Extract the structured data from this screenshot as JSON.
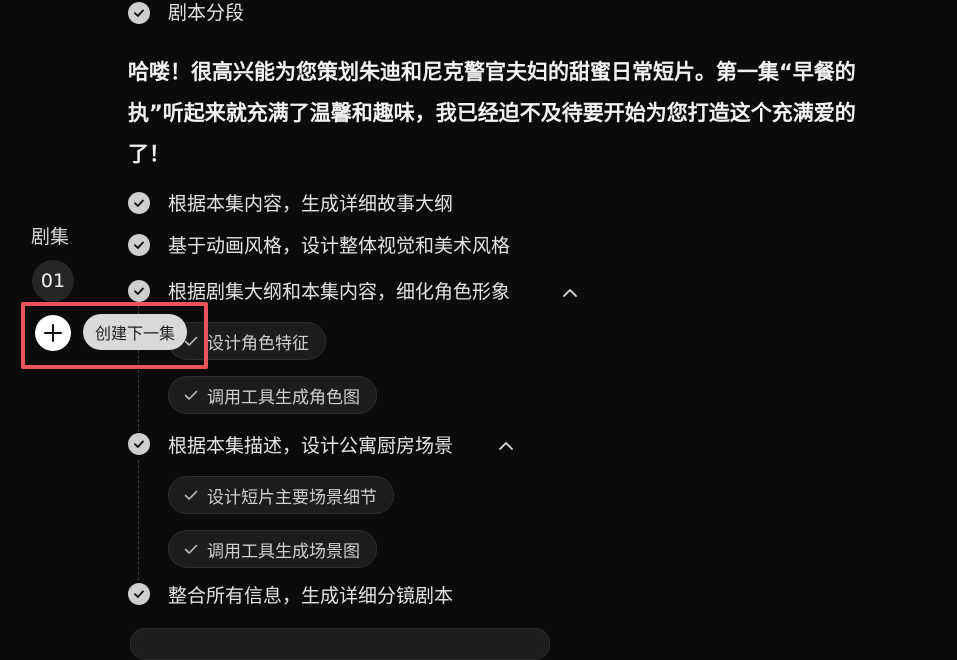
{
  "header_step": {
    "label": "剧本分段"
  },
  "intro": {
    "lines": [
      "哈喽！很高兴能为您策划朱迪和尼克警官夫妇的甜蜜日常短片。第一集“早餐的",
      "执”听起来就充满了温馨和趣味，我已经迫不及待要开始为您打造这个充满爱的",
      "了！"
    ]
  },
  "sidebar": {
    "title": "剧集",
    "episodes": [
      {
        "number": "01"
      }
    ],
    "add_tooltip": "创建下一集"
  },
  "steps": [
    {
      "label": "根据本集内容，生成详细故事大纲",
      "expandable": false
    },
    {
      "label": "基于动画风格，设计整体视觉和美术风格",
      "expandable": false
    },
    {
      "label": "根据剧集大纲和本集内容，细化角色形象",
      "expandable": true,
      "expanded": true,
      "substeps": [
        "设计角色特征",
        "调用工具生成角色图"
      ]
    },
    {
      "label": "根据本集描述，设计公寓厨房场景",
      "expandable": true,
      "expanded": true,
      "substeps": [
        "设计短片主要场景细节",
        "调用工具生成场景图"
      ]
    },
    {
      "label": "整合所有信息，生成详细分镜剧本",
      "expandable": false
    }
  ],
  "colors": {
    "background": "#0b0b0b",
    "highlight_border": "#e8545a",
    "check_fill": "#cfcfcf",
    "tooltip_bg": "#d9d9d9"
  },
  "icons": {
    "step_done": "check-circle-icon",
    "substep_done": "check-icon",
    "expand": "chevron-up-icon",
    "add_episode": "plus-icon"
  }
}
